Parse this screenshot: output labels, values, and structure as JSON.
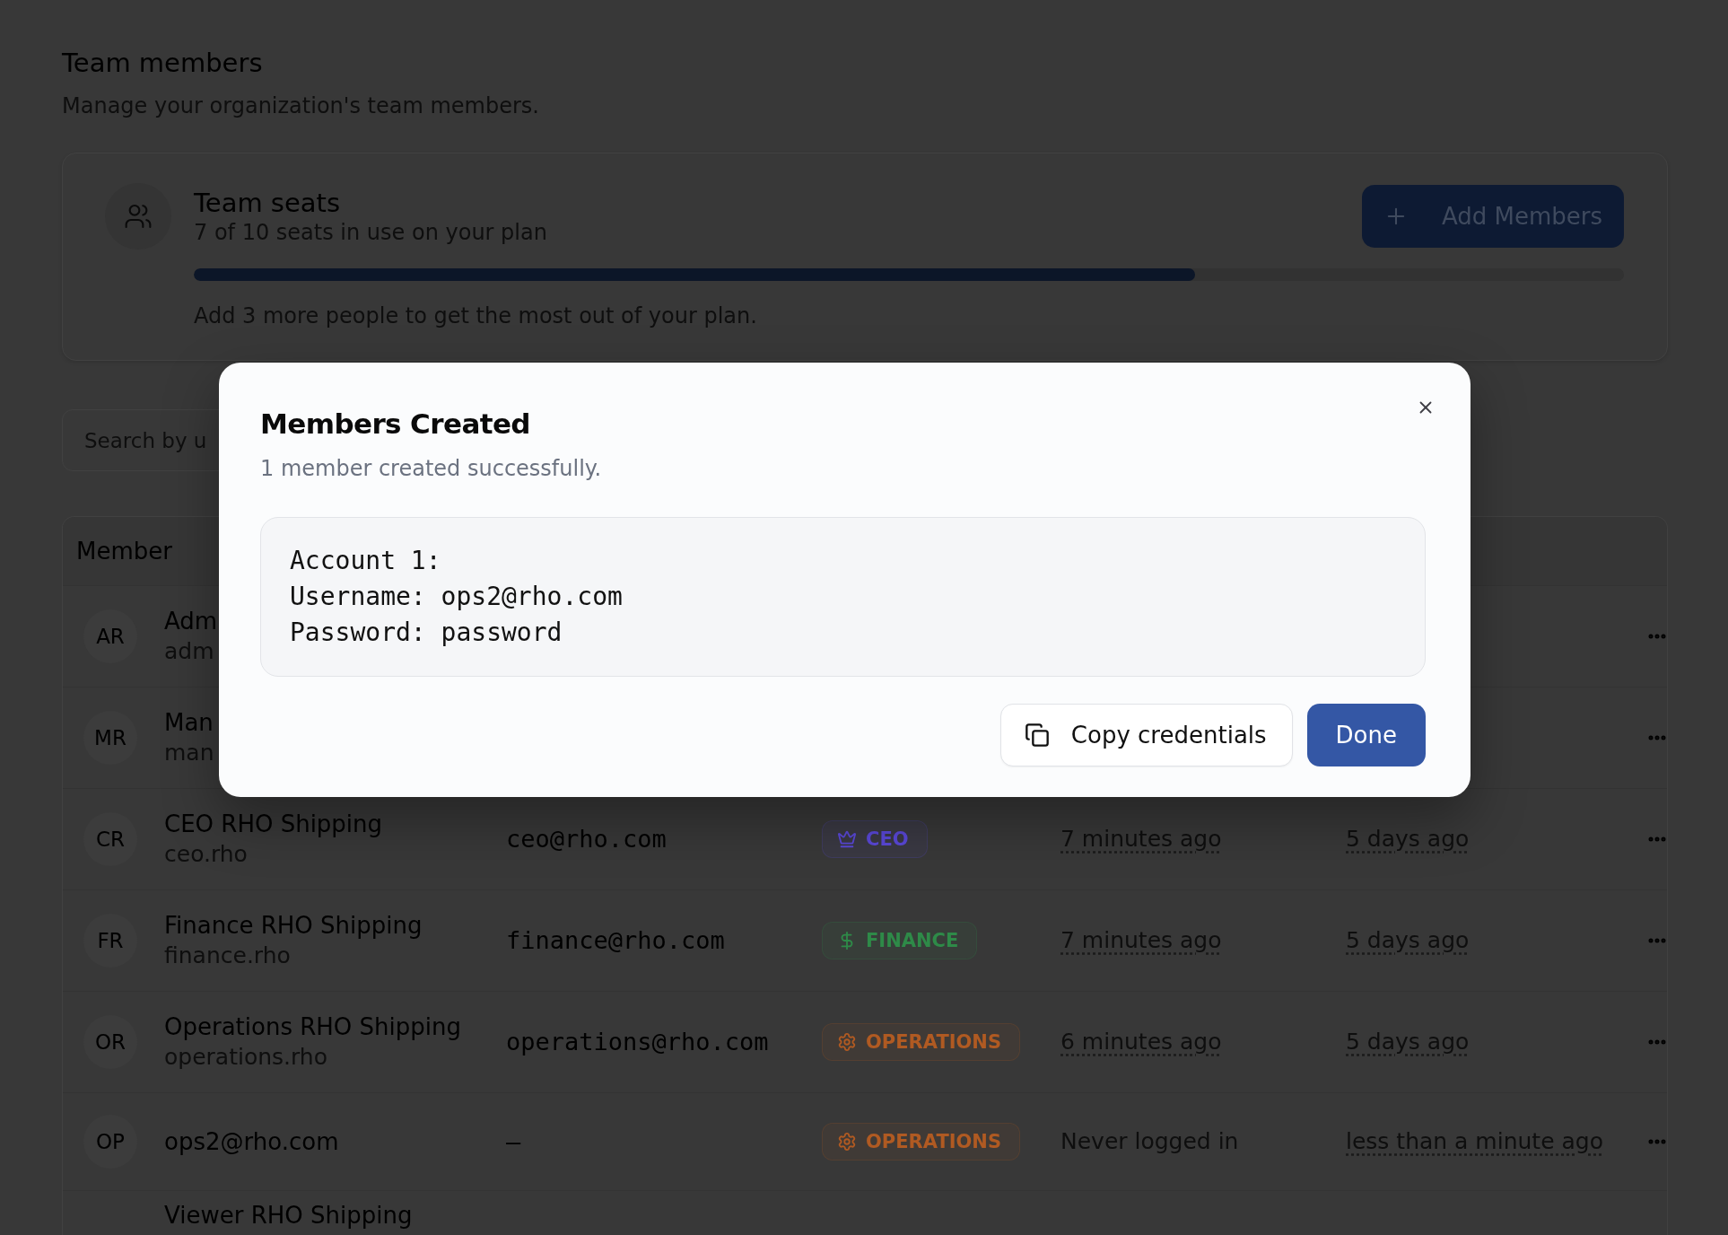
{
  "page": {
    "title": "Team members",
    "subtitle": "Manage your organization's team members."
  },
  "seats": {
    "title": "Team seats",
    "usage": "7 of 10 seats in use on your plan",
    "level": 0.7,
    "hint": "Add 3 more people to get the most out of your plan.",
    "add_button": "Add Members"
  },
  "search": {
    "placeholder": "Search by u"
  },
  "table": {
    "columns": [
      "Member"
    ],
    "rows": [
      {
        "initials": "AR",
        "name": "Adm",
        "username": "adm"
      },
      {
        "initials": "MR",
        "name": "Man",
        "username": "man"
      },
      {
        "initials": "CR",
        "name": "CEO RHO Shipping",
        "username": "ceo.rho",
        "email": "ceo@rho.com",
        "role": {
          "label": "CEO",
          "kind": "ceo",
          "color": "#5a48d8"
        },
        "last_login": {
          "text": "7 minutes ago",
          "kind": "relative"
        },
        "created": "5 days ago"
      },
      {
        "initials": "FR",
        "name": "Finance RHO Shipping",
        "username": "finance.rho",
        "email": "finance@rho.com",
        "role": {
          "label": "FINANCE",
          "kind": "finance",
          "color": "#2e8a48"
        },
        "last_login": {
          "text": "7 minutes ago",
          "kind": "relative"
        },
        "created": "5 days ago"
      },
      {
        "initials": "OR",
        "name": "Operations RHO Shipping",
        "username": "operations.rho",
        "email": "operations@rho.com",
        "role": {
          "label": "OPERATIONS",
          "kind": "operations",
          "color": "#b05a22"
        },
        "last_login": {
          "text": "6 minutes ago",
          "kind": "relative"
        },
        "created": "5 days ago"
      },
      {
        "initials": "OP",
        "name": "ops2@rho.com",
        "email": "—",
        "role": {
          "label": "OPERATIONS",
          "kind": "operations",
          "color": "#b05a22"
        },
        "last_login": {
          "text": "Never logged in",
          "kind": "never"
        },
        "created": "less than a minute ago"
      }
    ],
    "partial_row": {
      "name": "Viewer RHO Shipping"
    }
  },
  "dialog": {
    "title": "Members Created",
    "message": "1 member created successfully.",
    "credentials": [
      "Account 1:",
      "Username: ops2@rho.com",
      "Password: password"
    ],
    "buttons": [
      {
        "label": "Copy credentials",
        "kind": "copy"
      },
      {
        "label": "Done",
        "kind": "primary"
      }
    ]
  }
}
